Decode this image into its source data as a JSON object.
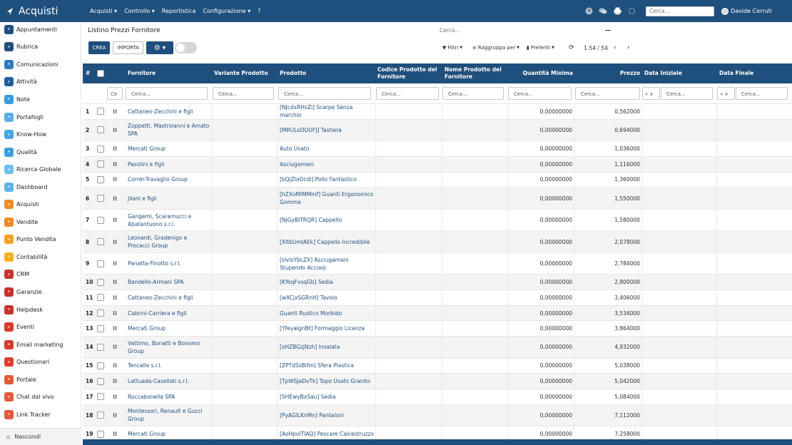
{
  "app": {
    "title": "Acquisti",
    "menu": [
      "Acquisti ▾",
      "Controllo ▾",
      "Reportistica",
      "Configurazione ▾",
      "?"
    ],
    "search_placeholder": "Cerca...",
    "user_name": "Davide Cerruti",
    "brand_color": "#1f4f7c"
  },
  "sidebar": {
    "items": [
      {
        "label": "Appuntamenti",
        "icon": "calendar-icon",
        "color": "#1f4f7c"
      },
      {
        "label": "Rubrica",
        "icon": "contacts-icon",
        "color": "#1f4f7c"
      },
      {
        "label": "Comunicazioni",
        "icon": "chat-icon",
        "color": "#2f7cc0"
      },
      {
        "label": "Attività",
        "icon": "check-icon",
        "color": "#1f5f9e"
      },
      {
        "label": "Note",
        "icon": "note-icon",
        "color": "#3a9be0"
      },
      {
        "label": "Portafogli",
        "icon": "wallet-icon",
        "color": "#5aaee8"
      },
      {
        "label": "Know-How",
        "icon": "lightbulb-icon",
        "color": "#4aa6e6"
      },
      {
        "label": "Qualità",
        "icon": "badge-icon",
        "color": "#39a0e0"
      },
      {
        "label": "Ricerca Globale",
        "icon": "search-icon",
        "color": "#6bc0ef"
      },
      {
        "label": "Dashboard",
        "icon": "dashboard-icon",
        "color": "#5bb5ea"
      },
      {
        "label": "Acquisti",
        "icon": "cart-icon",
        "color": "#f08a24"
      },
      {
        "label": "Vendite",
        "icon": "sales-icon",
        "color": "#f08a24"
      },
      {
        "label": "Punto Vendita",
        "icon": "store-icon",
        "color": "#f3a11f"
      },
      {
        "label": "Contabilità",
        "icon": "ledger-icon",
        "color": "#f3b21c"
      },
      {
        "label": "CRM",
        "icon": "crm-icon",
        "color": "#c8332b"
      },
      {
        "label": "Garanzie",
        "icon": "shield-icon",
        "color": "#c8332b"
      },
      {
        "label": "Helpdesk",
        "icon": "headset-icon",
        "color": "#c8332b"
      },
      {
        "label": "Eventi",
        "icon": "event-icon",
        "color": "#d93a2b"
      },
      {
        "label": "Email marketing",
        "icon": "mail-icon",
        "color": "#d93a2b"
      },
      {
        "label": "Questionari",
        "icon": "survey-icon",
        "color": "#e0402e"
      },
      {
        "label": "Portale",
        "icon": "portal-icon",
        "color": "#e45a3a"
      },
      {
        "label": "Chat dal vivo",
        "icon": "livechat-icon",
        "color": "#e45a3a"
      },
      {
        "label": "Link Tracker",
        "icon": "link-icon",
        "color": "#e8573b"
      }
    ],
    "hide_label": "Nascondi"
  },
  "control": {
    "breadcrumb": "Listino Prezzi Fornitore",
    "search_placeholder": "Cerca...",
    "create_label": "CREA",
    "import_label": "IMPORTA",
    "filters_label": "Filtri",
    "group_label": "Raggruppa per",
    "favorites_label": "Preferiti",
    "pager": "1-54 / 54"
  },
  "table": {
    "headers": [
      "#",
      "Fornitore",
      "Variante Prodotto",
      "Prodotto",
      "Codice Prodotto del Fornitore",
      "Nome Prodotto del Fornitore",
      "Quantità Minima",
      "Prezzo",
      "Data Iniziale",
      "Data Finale"
    ],
    "filter_placeholder": "Cerca...",
    "filter_narrow": "Ce",
    "date_sel": "« ∨",
    "rows": [
      {
        "n": "1",
        "supplier": "Cattaneo-Zecchini e figli",
        "product": "[NJcdxRHsZi] Scarpe Senza marchio",
        "qty": "0,00000000",
        "price": "0,562000"
      },
      {
        "n": "2",
        "supplier": "Zoppetti, Mastroianni e Amato SPA",
        "product": "[MRULoDOUFJ] Tastiera",
        "qty": "0,00000000",
        "price": "0,694000"
      },
      {
        "n": "3",
        "supplier": "Mercati Group",
        "product": "Auto Usato",
        "qty": "0,00000000",
        "price": "1,036000"
      },
      {
        "n": "4",
        "supplier": "Pasolini e figli",
        "product": "Asciugamani",
        "qty": "0,00000000",
        "price": "1,116000"
      },
      {
        "n": "5",
        "supplier": "Correr-Travaglio Group",
        "product": "[bQjZloOcdl] Pollo Fantastico",
        "qty": "0,00000000",
        "price": "1,360000"
      },
      {
        "n": "6",
        "supplier": "Jilani e figli",
        "product": "[hZXoMIMMmf] Guanti Ergonomico Gomma",
        "qty": "0,00000000",
        "price": "1,550000"
      },
      {
        "n": "7",
        "supplier": "Gangemi, Scaramucci e Abatantuono s.r.l.",
        "product": "[NjGyBITRQR] Cappello",
        "qty": "0,00000000",
        "price": "1,580000"
      },
      {
        "n": "8",
        "supplier": "Leonardi, Gradenigo e Procacci Group",
        "product": "[XltbUmIAEk] Cappello Incredibile",
        "qty": "0,00000000",
        "price": "2,078000"
      },
      {
        "n": "9",
        "supplier": "Panatta-Finotto s.r.l.",
        "product": "[slvlsYbLZX] Asciugamani Stupendo Acciaio",
        "qty": "0,00000000",
        "price": "2,784000"
      },
      {
        "n": "10",
        "supplier": "Bandello-Armani SPA",
        "product": "[KYoqFvsqGb] Sedia",
        "qty": "0,00000000",
        "price": "2,800000"
      },
      {
        "n": "11",
        "supplier": "Cattaneo-Zecchini e figli",
        "product": "[wXCjxSGRnH] Tavolo",
        "qty": "0,00000000",
        "price": "3,406000"
      },
      {
        "n": "12",
        "supplier": "Cabrini-Carriera e figli",
        "product": "Guanti Rustico Morbido",
        "qty": "0,00000000",
        "price": "3,534000"
      },
      {
        "n": "13",
        "supplier": "Mercati Group",
        "product": "[YfeyalgnBt] Formaggio Licenza",
        "qty": "0,00000000",
        "price": "3,864000"
      },
      {
        "n": "14",
        "supplier": "Vattimo, Bonatti e Bonomo Group",
        "product": "[xHZBGzjNzh] Insalata",
        "qty": "0,00000000",
        "price": "4,932000"
      },
      {
        "n": "15",
        "supplier": "Tencalla s.r.l.",
        "product": "[ZPTdSsBifm] Sfera Plastica",
        "qty": "0,00000000",
        "price": "5,038000"
      },
      {
        "n": "16",
        "supplier": "Lattuada-Casellati s.r.l.",
        "product": "[TpWSJaDvTk] Topo Usato Granito",
        "qty": "0,00000000",
        "price": "5,042000"
      },
      {
        "n": "17",
        "supplier": "Roccabonella SPA",
        "product": "[SHEwyBxSau] Sedia",
        "qty": "0,00000000",
        "price": "5,084000"
      },
      {
        "n": "18",
        "supplier": "Montessori, Renault e Gucci Group",
        "product": "[PyAGILKnMn] Pantaloni",
        "qty": "0,00000000",
        "price": "7,112000"
      },
      {
        "n": "19",
        "supplier": "Mercati Group",
        "product": "[AoHpolTIAQ] Pescare Calcestruzzo",
        "qty": "0,00000000",
        "price": "7,258000"
      }
    ]
  }
}
